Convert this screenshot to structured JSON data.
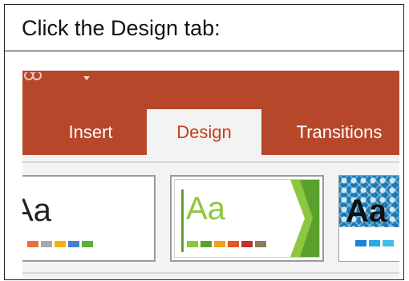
{
  "instruction": {
    "text": "Click the Design tab:"
  },
  "ribbon": {
    "color": "#b7472a",
    "tabs": [
      {
        "label": "Insert",
        "selected": false
      },
      {
        "label": "Design",
        "selected": true
      },
      {
        "label": "Transitions",
        "selected": false
      }
    ],
    "quick_access_icon": "qat-customize-icon"
  },
  "themes": [
    {
      "sample": "Aa",
      "text_color": "#222222",
      "swatches": [
        "#e86f3c",
        "#a8a8a8",
        "#f4b400",
        "#4a7fd0",
        "#5fae3b"
      ]
    },
    {
      "sample": "Aa",
      "text_color": "#8dc63f",
      "swatches": [
        "#8dc63f",
        "#5aa02c",
        "#f4a020",
        "#e05a20",
        "#c0302a",
        "#8b7d5a"
      ]
    },
    {
      "sample": "Aa",
      "text_color": "#111111",
      "swatches": [
        "#1f84d6",
        "#2aa8e0",
        "#40c0e8"
      ]
    }
  ]
}
